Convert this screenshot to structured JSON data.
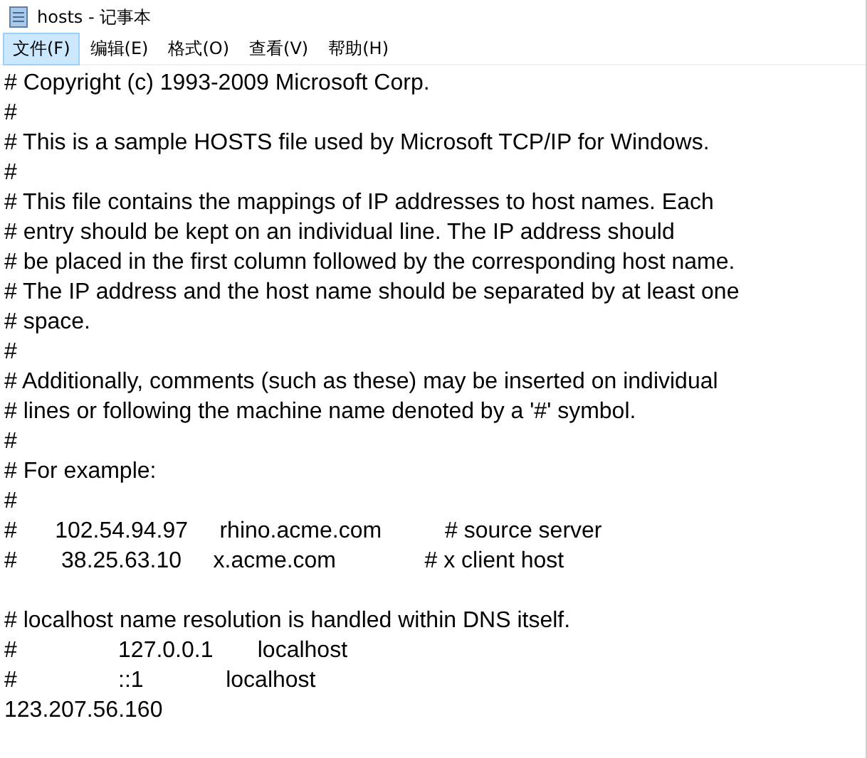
{
  "window": {
    "title": "hosts - 记事本"
  },
  "menu": [
    {
      "label": "文件(F)",
      "selected": true
    },
    {
      "label": "编辑(E)",
      "selected": false
    },
    {
      "label": "格式(O)",
      "selected": false
    },
    {
      "label": "查看(V)",
      "selected": false
    },
    {
      "label": "帮助(H)",
      "selected": false
    }
  ],
  "editor": {
    "blocks": [
      [
        "# Copyright (c) 1993-2009 Microsoft Corp.",
        "#",
        "# This is a sample HOSTS file used by Microsoft TCP/IP for Windows.",
        "#",
        "# This file contains the mappings of IP addresses to host names. Each",
        "# entry should be kept on an individual line. The IP address should",
        "# be placed in the first column followed by the corresponding host name.",
        "# The IP address and the host name should be separated by at least one",
        "# space.",
        "#",
        "# Additionally, comments (such as these) may be inserted on individual",
        "# lines or following the machine name denoted by a '#' symbol.",
        "#",
        "# For example:",
        "#",
        "#      102.54.94.97     rhino.acme.com          # source server",
        "#       38.25.63.10     x.acme.com              # x client host"
      ],
      [
        "# localhost name resolution is handled within DNS itself.",
        "#\t127.0.0.1       localhost",
        "#\t::1             localhost",
        "123.207.56.160"
      ]
    ]
  }
}
